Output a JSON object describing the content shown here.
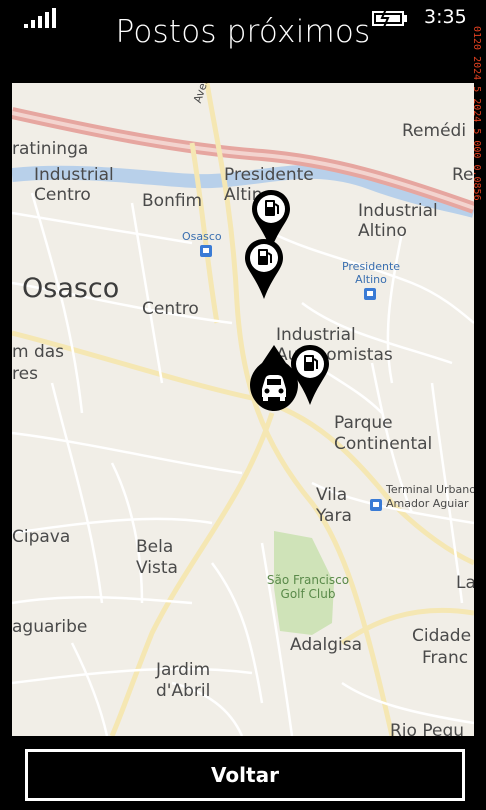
{
  "status_bar": {
    "time": "3:35"
  },
  "debug_overlay": "0120 2024 5 2024 5 000 0.0856",
  "page": {
    "title": "Postos próximos"
  },
  "map": {
    "labels": {
      "avenida": "Avenida",
      "remedios": "Remédi",
      "ratininga": "ratininga",
      "industrial_centro": "Industrial Centro",
      "presidente_altino": "Presidente Altino",
      "bonfim": "Bonfim",
      "industrial_altino": "Industrial Altino",
      "re": "Re",
      "osasco_station": "Osasco",
      "osasco": "Osasco",
      "pres_altino_station": "Presidente Altino",
      "centro": "Centro",
      "industrial_autonomistas": "Industrial Autonomistas",
      "m_das": "m das",
      "res": "res",
      "parque_continental": "Parque Continental",
      "vila_yara": "Vila Yara",
      "terminal": "Terminal Urbano Amador Aguiar",
      "cipava": "Cipava",
      "bela_vista": "Bela Vista",
      "golf": "São Francisco Golf Club",
      "la": "La",
      "aguaribe": "aguaribe",
      "adalgisa": "Adalgisa",
      "cidade": "Cidade",
      "franc": "Franc",
      "jardim_abril": "Jardim d'Abril",
      "rio_pequ": "Rio Pequ"
    },
    "markers": [
      {
        "type": "fuel-station"
      },
      {
        "type": "fuel-station"
      },
      {
        "type": "fuel-station"
      },
      {
        "type": "current-location-car"
      }
    ]
  },
  "actions": {
    "back_label": "Voltar"
  }
}
